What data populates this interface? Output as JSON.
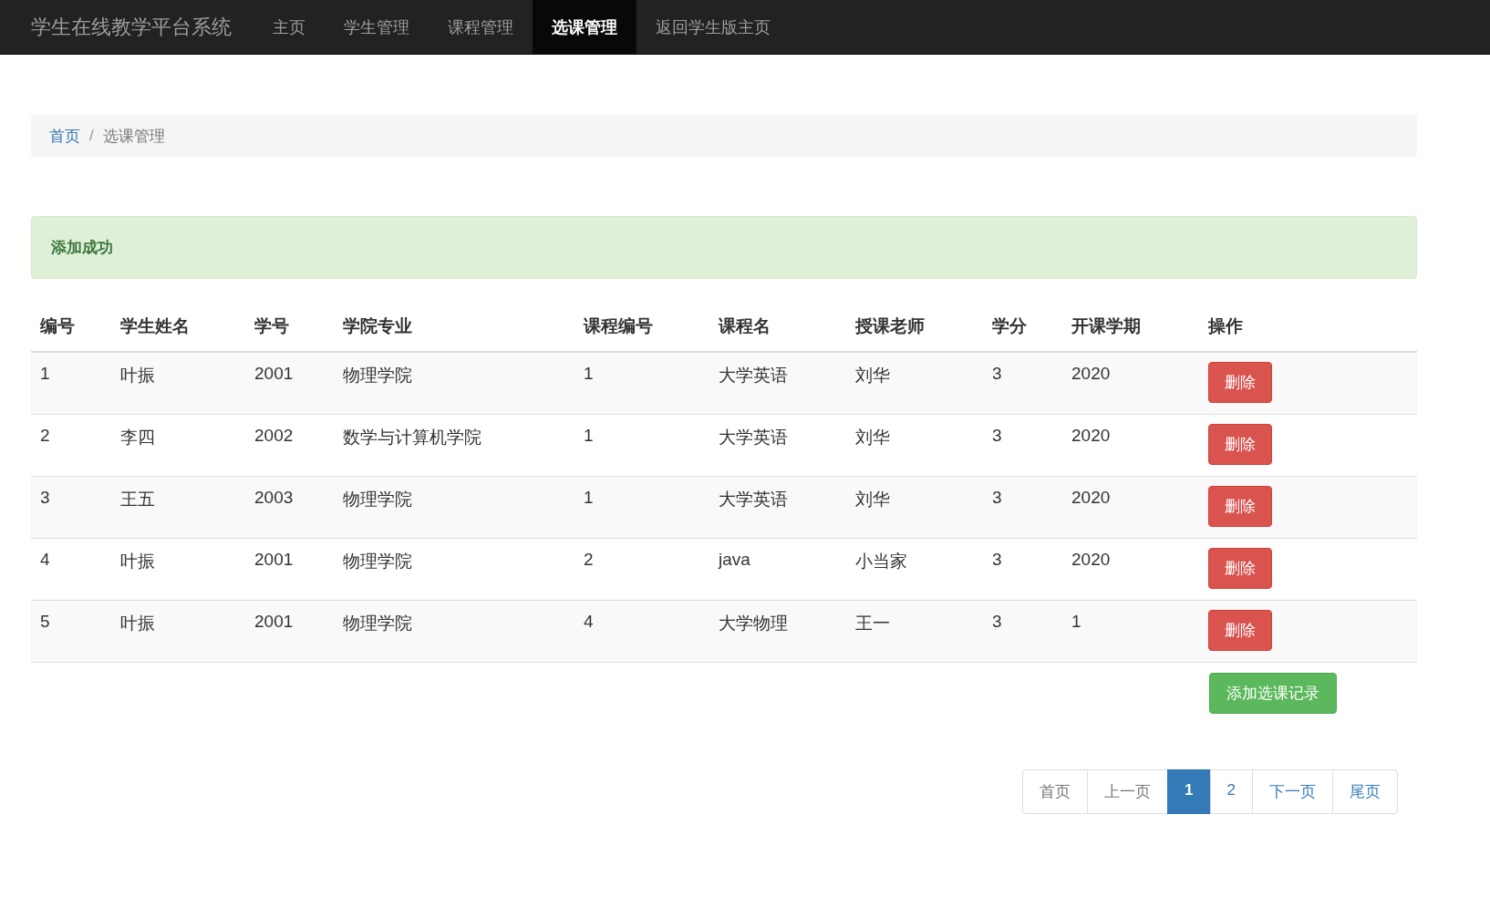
{
  "navbar": {
    "brand": "学生在线教学平台系统",
    "items": [
      {
        "label": "主页",
        "selected": false
      },
      {
        "label": "学生管理",
        "selected": false
      },
      {
        "label": "课程管理",
        "selected": false
      },
      {
        "label": "选课管理",
        "selected": true
      },
      {
        "label": "返回学生版主页",
        "selected": false
      }
    ]
  },
  "breadcrumb": {
    "link": "首页",
    "separator": "/",
    "current": "选课管理"
  },
  "alert": {
    "message": "添加成功"
  },
  "table": {
    "columns": [
      "编号",
      "学生姓名",
      "学号",
      "学院专业",
      "课程编号",
      "课程名",
      "授课老师",
      "学分",
      "开课学期",
      "操作"
    ],
    "rows": [
      {
        "cells": [
          "1",
          "叶振",
          "2001",
          "物理学院",
          "1",
          "大学英语",
          "刘华",
          "3",
          "2020"
        ],
        "action": "删除"
      },
      {
        "cells": [
          "2",
          "李四",
          "2002",
          "数学与计算机学院",
          "1",
          "大学英语",
          "刘华",
          "3",
          "2020"
        ],
        "action": "删除"
      },
      {
        "cells": [
          "3",
          "王五",
          "2003",
          "物理学院",
          "1",
          "大学英语",
          "刘华",
          "3",
          "2020"
        ],
        "action": "删除"
      },
      {
        "cells": [
          "4",
          "叶振",
          "2001",
          "物理学院",
          "2",
          "java",
          "小当家",
          "3",
          "2020"
        ],
        "action": "删除"
      },
      {
        "cells": [
          "5",
          "叶振",
          "2001",
          "物理学院",
          "4",
          "大学物理",
          "王一",
          "3",
          "1"
        ],
        "action": "删除"
      }
    ]
  },
  "add_button": "添加选课记录",
  "pagination": [
    {
      "label": "首页",
      "selected": false,
      "disabled": true
    },
    {
      "label": "上一页",
      "selected": false,
      "disabled": true
    },
    {
      "label": "1",
      "selected": true,
      "disabled": false
    },
    {
      "label": "2",
      "selected": false,
      "disabled": false
    },
    {
      "label": "下一页",
      "selected": false,
      "disabled": false
    },
    {
      "label": "尾页",
      "selected": false,
      "disabled": false
    }
  ]
}
